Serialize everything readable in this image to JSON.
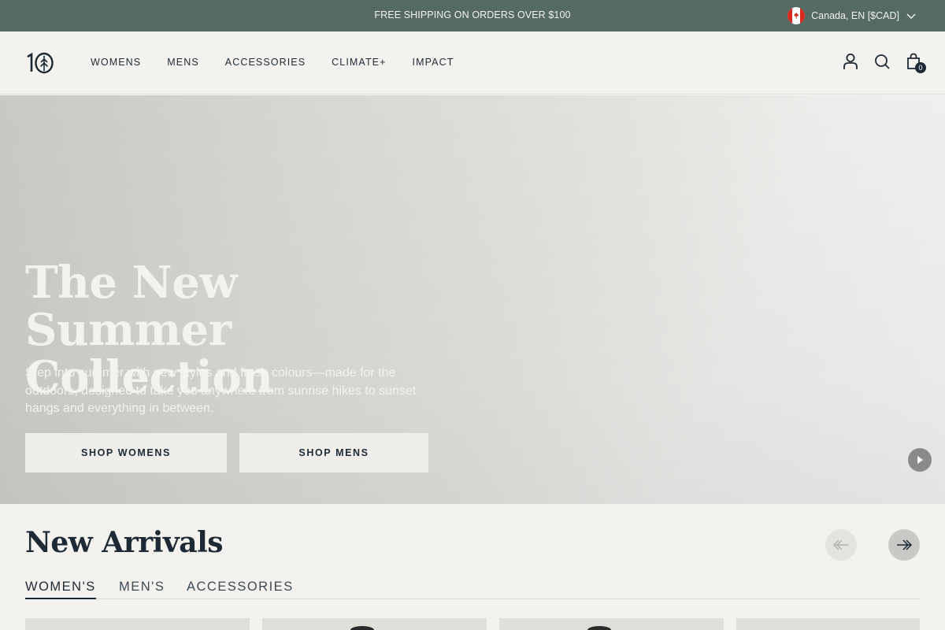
{
  "announcement": {
    "text": "FREE SHIPPING ON ORDERS OVER $100",
    "locale": "Canada, EN [$CAD]"
  },
  "header": {
    "logo": "10",
    "nav": [
      "WOMENS",
      "MENS",
      "ACCESSORIES",
      "CLIMATE+",
      "IMPACT"
    ],
    "cart_count": "0"
  },
  "hero": {
    "title": "The New Summer Collection",
    "text": "Step into summer with new styles and fresh colours—made for the outdoors, designed to take you anywhere from sunrise hikes to sunset hangs and everything in between.",
    "buttons": [
      "SHOP WOMENS",
      "SHOP MENS"
    ]
  },
  "new_arrivals": {
    "title": "New Arrivals",
    "tabs": [
      "WOMEN'S",
      "MEN'S",
      "ACCESSORIES"
    ],
    "active_tab": "WOMEN'S"
  },
  "colors": {
    "announcement_bg": "#546a62",
    "text_dark": "#1d2a35",
    "page_bg": "#f3f2ee"
  },
  "icons": [
    "account-icon",
    "search-icon",
    "cart-icon",
    "chevron-down-icon",
    "play-icon",
    "arrow-left-icon",
    "arrow-right-icon"
  ]
}
